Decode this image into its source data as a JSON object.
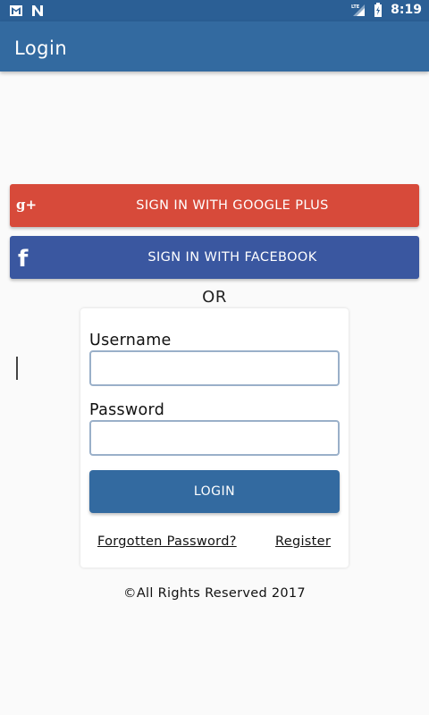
{
  "status_bar": {
    "time": "8:19",
    "left_icons": [
      "gmail-icon",
      "n-notification-icon"
    ],
    "right_icons": [
      "lte-signal-icon",
      "battery-charging-icon"
    ],
    "background": "#2b5f95"
  },
  "app_bar": {
    "title": "Login",
    "background": "#336aa0"
  },
  "social": {
    "google": {
      "label": "SIGN IN WITH GOOGLE PLUS",
      "icon": "google-plus-icon",
      "icon_text": "g+",
      "color": "#d74a3a"
    },
    "facebook": {
      "label": "SIGN IN WITH FACEBOOK",
      "icon": "facebook-icon",
      "icon_text": "f",
      "color": "#3a57a0"
    }
  },
  "divider_text": "OR",
  "form": {
    "username": {
      "label": "Username",
      "value": ""
    },
    "password": {
      "label": "Password",
      "value": ""
    },
    "login_label": "LOGIN",
    "forgot_label": "Forgotten Password?",
    "register_label": "Register"
  },
  "footer": "©All Rights Reserved 2017"
}
